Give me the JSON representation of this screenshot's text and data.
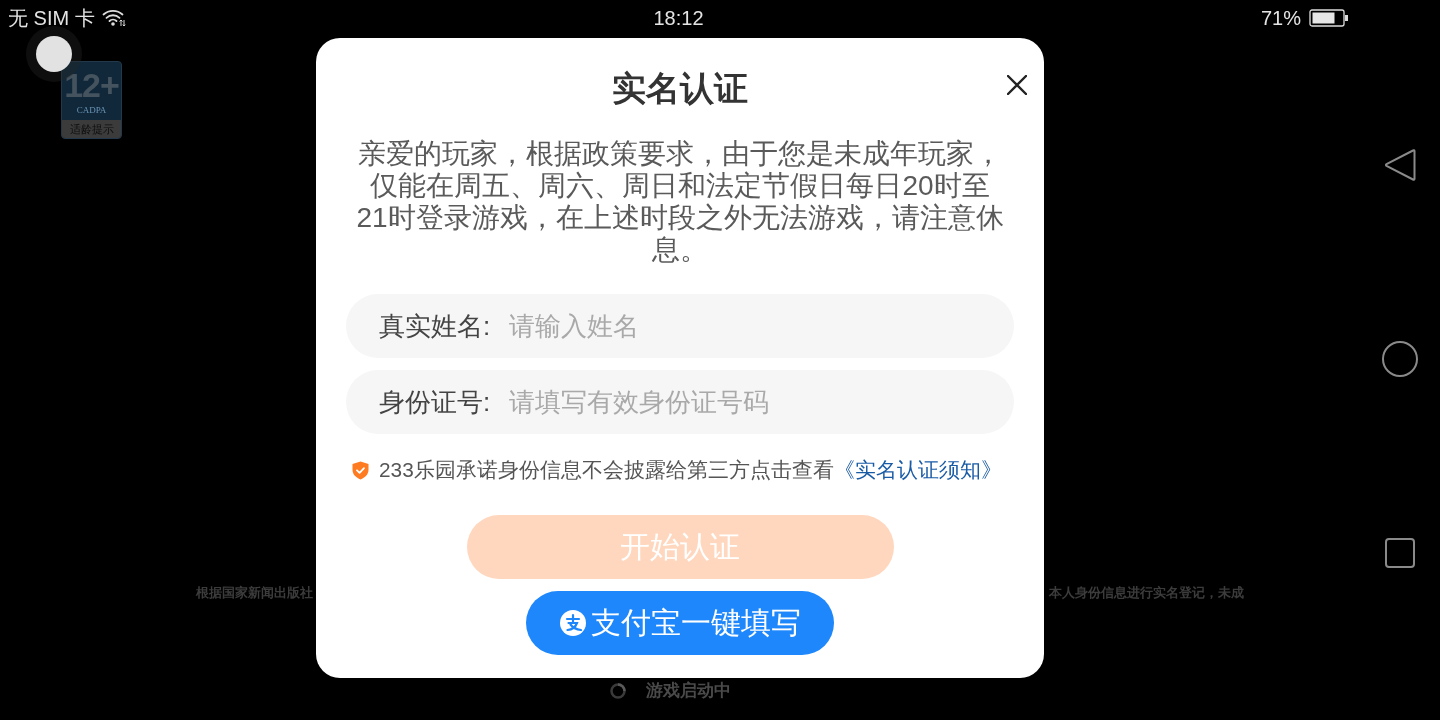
{
  "status_bar": {
    "carrier": "无 SIM 卡",
    "time": "18:12",
    "battery": "71%"
  },
  "age_badge": {
    "rating": "12+",
    "org": "CADPA",
    "caption": "适龄提示"
  },
  "background_notice": {
    "left": "根据国家新闻出版社",
    "right": "本人身份信息进行实名登记，未成"
  },
  "loading": {
    "text": "游戏启动中"
  },
  "dialog": {
    "title": "实名认证",
    "message": "亲爱的玩家，根据政策要求，由于您是未成年玩家，仅能在周五、周六、周日和法定节假日每日20时至21时登录游戏，在上述时段之外无法游戏，请注意休息。",
    "fields": [
      {
        "label": "真实姓名:",
        "placeholder": "请输入姓名"
      },
      {
        "label": "身份证号:",
        "placeholder": "请填写有效身份证号码"
      }
    ],
    "privacy_note": {
      "text": "233乐园承诺身份信息不会披露给第三方点击查看",
      "link": "《实名认证须知》"
    },
    "buttons": [
      {
        "kind": "primary",
        "label": "开始认证",
        "disabled": true
      },
      {
        "kind": "alipay",
        "label": "支付宝一键填写",
        "disabled": false
      }
    ]
  }
}
